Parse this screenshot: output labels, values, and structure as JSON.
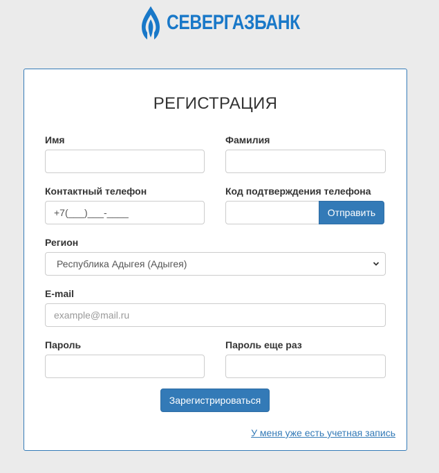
{
  "brand": {
    "name": "СЕВЕРГАЗБАНК",
    "logo_icon": "flame-icon",
    "color": "#1978c8"
  },
  "form": {
    "title": "РЕГИСТРАЦИЯ",
    "first_name": {
      "label": "Имя",
      "value": ""
    },
    "last_name": {
      "label": "Фамилия",
      "value": ""
    },
    "phone": {
      "label": "Контактный телефон",
      "value": "+7(___)___-____"
    },
    "phone_code": {
      "label": "Код подтверждения телефона",
      "value": "",
      "send_label": "Отправить"
    },
    "region": {
      "label": "Регион",
      "selected": "Республика Адыгея (Адыгея)"
    },
    "email": {
      "label": "E-mail",
      "placeholder": "example@mail.ru",
      "value": ""
    },
    "password": {
      "label": "Пароль",
      "value": ""
    },
    "password_repeat": {
      "label": "Пароль еще раз",
      "value": ""
    },
    "submit_label": "Зарегистрироваться",
    "login_link": "У меня уже есть учетная запись"
  },
  "colors": {
    "accent": "#337ab7",
    "page_bg": "#ebebeb"
  }
}
